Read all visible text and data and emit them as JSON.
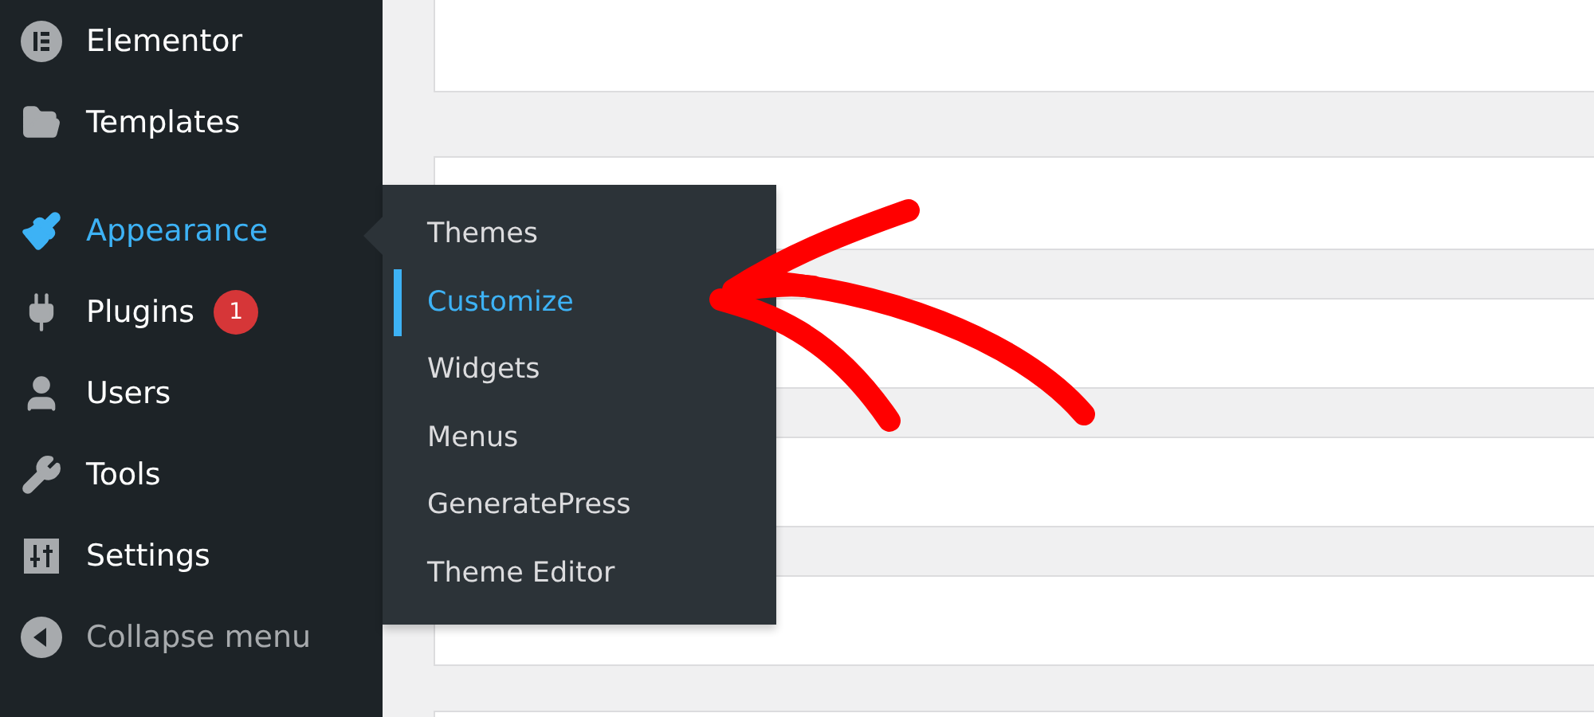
{
  "sidebar": {
    "groups": [
      [
        {
          "label": "Elementor",
          "selected": false
        },
        {
          "label": "Templates",
          "selected": false
        }
      ],
      [
        {
          "label": "Appearance",
          "selected": true
        },
        {
          "label": "Plugins",
          "selected": false,
          "badge": "1"
        },
        {
          "label": "Users",
          "selected": false
        },
        {
          "label": "Tools",
          "selected": false
        },
        {
          "label": "Settings",
          "selected": false
        }
      ]
    ],
    "collapse_button": {
      "label": "Collapse menu"
    }
  },
  "submenu": {
    "items": [
      {
        "label": "Themes",
        "selected": false
      },
      {
        "label": "Customize",
        "selected": true
      },
      {
        "label": "Widgets",
        "selected": false
      },
      {
        "label": "Menus",
        "selected": false
      },
      {
        "label": "GeneratePress",
        "selected": false
      },
      {
        "label": "Theme Editor",
        "selected": false
      }
    ]
  }
}
